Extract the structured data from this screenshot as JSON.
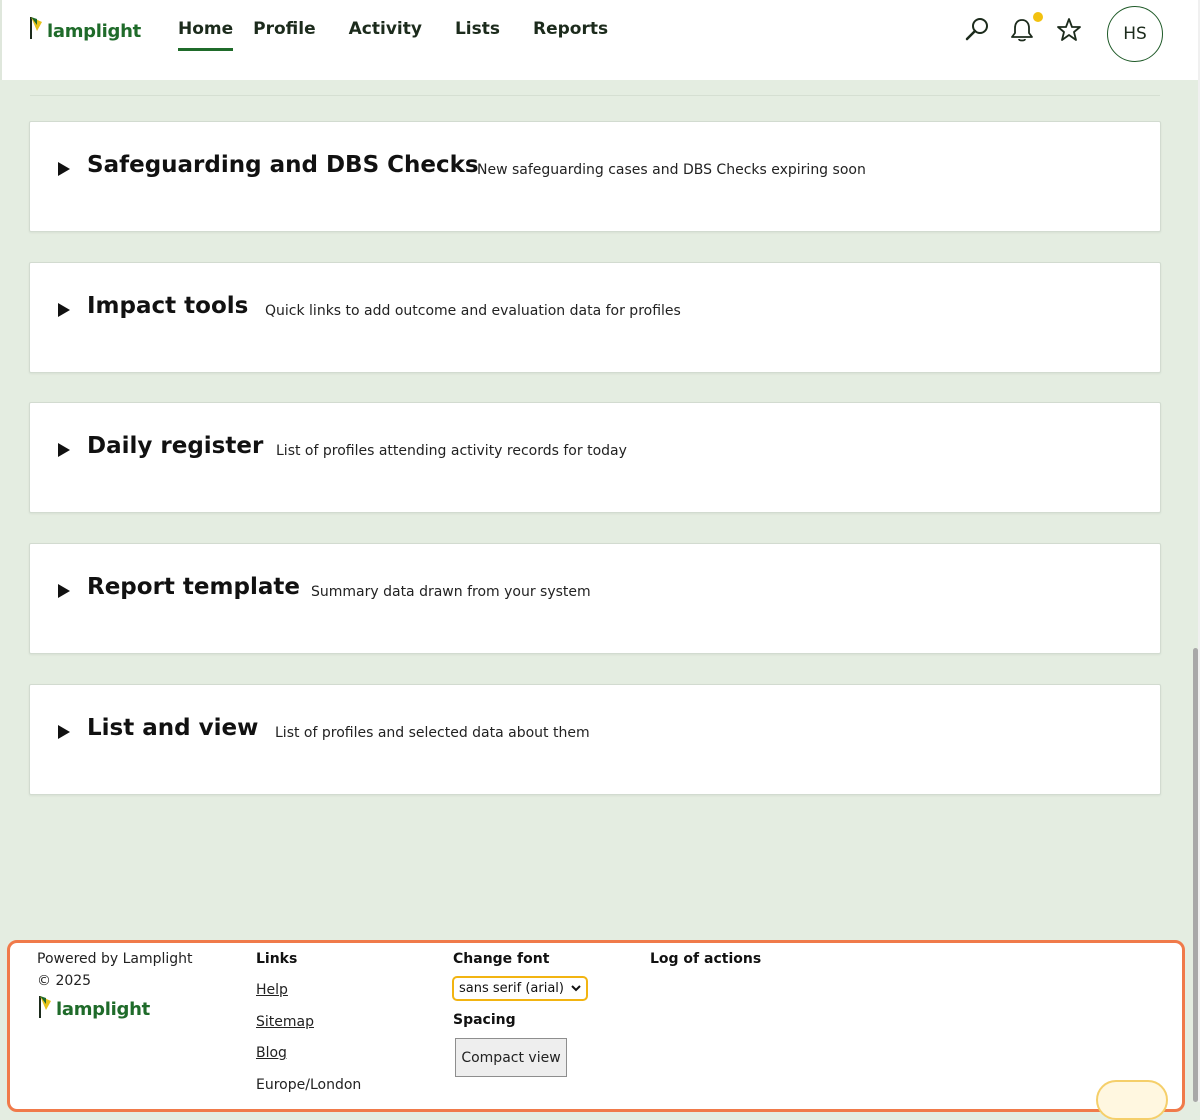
{
  "app": {
    "name": "lamplight"
  },
  "nav": {
    "items": [
      {
        "label": "Home",
        "active": true
      },
      {
        "label": "Profile"
      },
      {
        "label": "Activity"
      },
      {
        "label": "Lists"
      },
      {
        "label": "Reports"
      }
    ]
  },
  "header": {
    "search_icon": "search-icon",
    "notifications_icon": "bell-icon",
    "favourites_icon": "star-icon",
    "avatar_initials": "HS",
    "notification_dot_color": "#f2c10f"
  },
  "cards": [
    {
      "title": "Safeguarding and DBS Checks",
      "description": "New safeguarding cases and DBS Checks expiring soon"
    },
    {
      "title": "Impact tools",
      "description": "Quick links to add outcome and evaluation data for profiles"
    },
    {
      "title": "Daily register",
      "description": "List of profiles attending activity records for today"
    },
    {
      "title": "Report template",
      "description": "Summary data drawn from your system"
    },
    {
      "title": "List and view",
      "description": "List of profiles and selected data about them"
    }
  ],
  "footer": {
    "powered_by": "Powered by Lamplight",
    "copyright": "© 2025",
    "logo_text": "lamplight",
    "links_heading": "Links",
    "links": [
      "Help",
      "Sitemap",
      "Blog"
    ],
    "timezone": "Europe/London",
    "change_font_heading": "Change font",
    "font_select_value": "sans serif (arial)",
    "spacing_heading": "Spacing",
    "compact_view_label": "Compact view",
    "log_heading": "Log of actions",
    "highlight_color": "#f07a4a"
  },
  "colors": {
    "brand_green": "#1f6b2a",
    "page_bg": "#e4ede1",
    "select_focus": "#f2b411"
  }
}
